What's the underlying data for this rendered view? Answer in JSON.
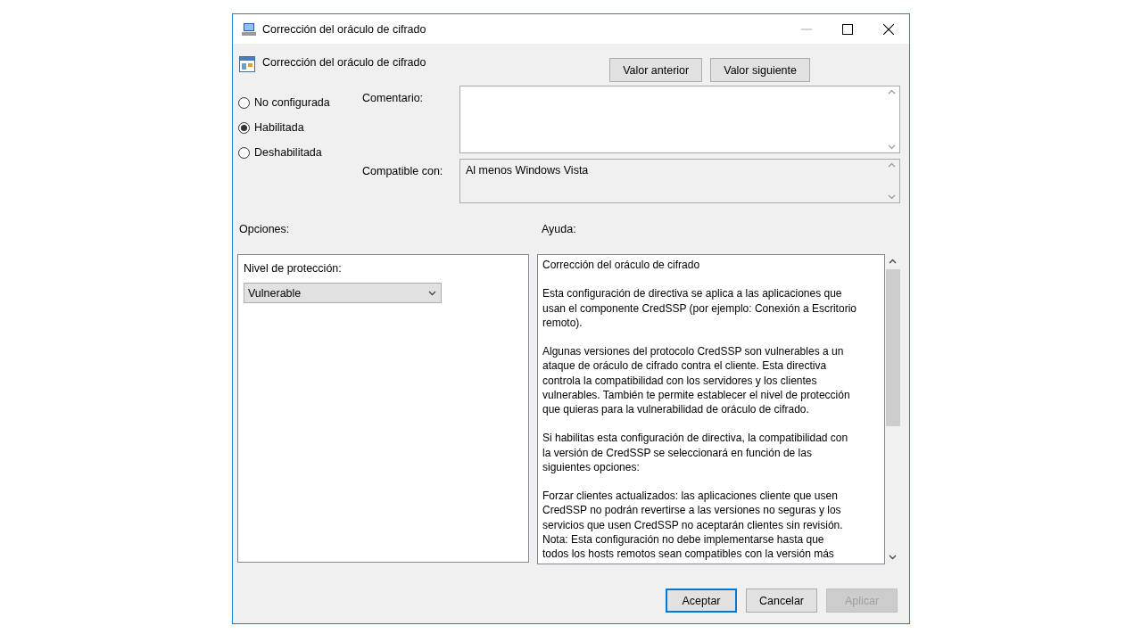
{
  "window": {
    "title": "Corrección del oráculo de cifrado"
  },
  "setting_title": "Corrección del oráculo de cifrado",
  "nav_buttons": [
    {
      "label": "Valor anterior"
    },
    {
      "label": "Valor siguiente"
    }
  ],
  "states": [
    {
      "label": "No configurada",
      "selected": false
    },
    {
      "label": "Habilitada",
      "selected": true
    },
    {
      "label": "Deshabilitada",
      "selected": false
    }
  ],
  "comment": {
    "label": "Comentario:"
  },
  "supported_on": {
    "label": "Compatible con:",
    "value": "Al menos Windows Vista"
  },
  "options": {
    "heading": "Opciones:",
    "field_label": "Nivel de protección:",
    "dropdown_value": "Vulnerable"
  },
  "help": {
    "heading": "Ayuda:",
    "paragraphs": [
      "Corrección del oráculo de cifrado",
      "Esta configuración de directiva se aplica a las aplicaciones que\nusan el componente CredSSP (por ejemplo: Conexión a Escritorio\nremoto).",
      "Algunas versiones del protocolo CredSSP son vulnerables a un\nataque de oráculo de cifrado contra el cliente. Esta directiva\ncontrola la compatibilidad con los servidores y los clientes\nvulnerables. También te permite establecer el nivel de protección\nque quieras para la vulnerabilidad de oráculo de cifrado.",
      "Si habilitas esta configuración de directiva, la compatibilidad con\nla versión de CredSSP se seleccionará en función de las\nsiguientes opciones:",
      "Forzar clientes actualizados: las aplicaciones cliente que usen\nCredSSP no podrán revertirse a las versiones no seguras y los\nservicios que usen CredSSP no aceptarán clientes sin revisión.\nNota: Esta configuración no debe implementarse hasta que\ntodos los hosts remotos sean compatibles con la versión más"
    ]
  },
  "footer_buttons": [
    {
      "label": "Aceptar",
      "default": true,
      "disabled": false
    },
    {
      "label": "Cancelar",
      "default": false,
      "disabled": false
    },
    {
      "label": "Aplicar",
      "default": false,
      "disabled": true
    }
  ]
}
